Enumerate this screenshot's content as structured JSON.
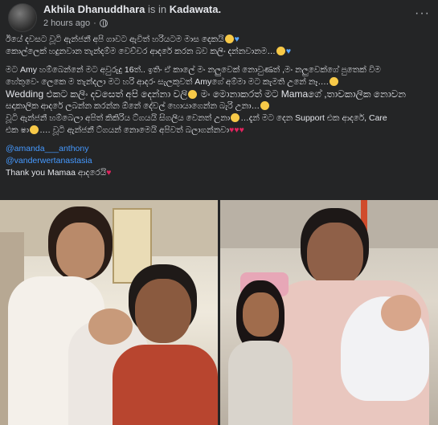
{
  "header": {
    "author": "Akhila Dhanuddhara",
    "is_in": "is in",
    "location": "Kadawata.",
    "time": "2 hours ago",
    "privacy_sep": "·",
    "more": "···"
  },
  "post": {
    "line1": "ඊයේ දවසට වූටි ඇන්ජනී අපි ගාවට ඇවිත් හරියටම මාස දෙකයි",
    "line2": "කොල්ලෙක් හදුනවාන තැන්දම්ම වෙච්චර ආදරේ කරන බව කලිං දන්නවානම…",
    "line3": "මට Amy හම්බෙන්නේ මට අවුරුදු 16ත්.. ඉතිං ඒ කාලේ මං නලුවෙක් නොවුණත් ,මං නලුවෙක්ගේ පුතෙක් විම",
    "line4": "හේතුවෙං ලෙකෙ ම තැන්දලා මට හරි ආදරං සැලකුවත් Amyගේ අම්මා මට කැමති උනේ නෑ….",
    "line5": "Wedding එකට කලිං දවසෙත් අපි දෙන්නා වලි",
    "line5b": "මං මොනාකරත් මට Mamaගේ ,තාවකාලික නොවන",
    "line6": "සදාකාලික ආදරේ ලබන්න කරන්න ඕනේ දේවල් හොයාගෙන්න බැරි උනා…",
    "line7": "වූටි ඇන්ජනී හම්බෙලා අපිත් කිකිරිය ට්ගයයි සිගලිය වෙනත් උනා",
    "line7b": "…දැන් මට දෙන Support එක ආදරේ, Care",
    "line8": "එක ෂා",
    "line8b": "…. වූටි ඇන්ජනී ට්ගයන් නොමෙයි අපිවත් බලාගන්නවා",
    "mention1": "@amanda___anthony",
    "mention2": "@vanderwertanastasia",
    "thanks": "Thank you Mamaa ආදරෙයි"
  },
  "icons": [
    "globe-icon",
    "more-icon"
  ],
  "colors": {
    "background": "#242526",
    "text": "#e4e6eb",
    "muted": "#b0b3b8",
    "link": "#4599ff",
    "heart": "#e0245e"
  }
}
